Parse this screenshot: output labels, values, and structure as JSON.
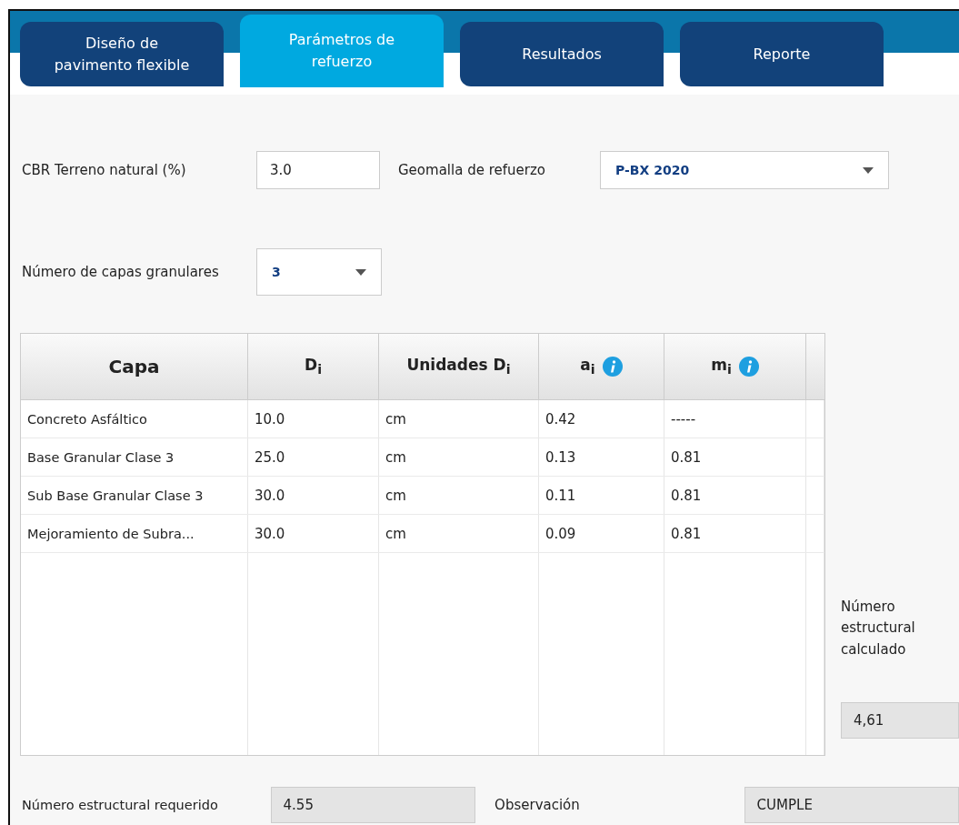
{
  "tabs": [
    {
      "label": "Diseño de\npavimento flexible",
      "selected": false
    },
    {
      "label": "Parámetros de\nrefuerzo",
      "selected": true
    },
    {
      "label": "Resultados",
      "selected": false
    },
    {
      "label": "Reporte",
      "selected": false
    }
  ],
  "cbr": {
    "label": "CBR Terreno natural (%)",
    "value": "3.0"
  },
  "geogrid": {
    "label": "Geomalla de refuerzo",
    "value": "P-BX 2020"
  },
  "layers_count": {
    "label": "Número de capas granulares",
    "value": "3"
  },
  "table": {
    "columns": [
      {
        "label": "Capa",
        "info": false
      },
      {
        "label": "D$_{i}$",
        "info": false
      },
      {
        "label": "Unidades D$_{i}$",
        "info": false
      },
      {
        "label": "a$_{i}$",
        "info": true
      },
      {
        "label": "m$_{i}$",
        "info": true
      }
    ],
    "rows": [
      [
        "Concreto Asfáltico",
        "10.0",
        "cm",
        "0.42",
        "-----"
      ],
      [
        "Base Granular Clase 3",
        "25.0",
        "cm",
        "0.13",
        "0.81"
      ],
      [
        "Sub Base Granular Clase 3",
        "30.0",
        "cm",
        "0.11",
        "0.81"
      ],
      [
        "Mejoramiento de Subra...",
        "30.0",
        "cm",
        "0.09",
        "0.81"
      ]
    ]
  },
  "calculated": {
    "label": "Número\nestructural\ncalculado",
    "value": "4,61"
  },
  "required": {
    "label": "Número estructural requerido",
    "value": "4.55"
  },
  "observation": {
    "label": "Observación",
    "value": "CUMPLE"
  }
}
